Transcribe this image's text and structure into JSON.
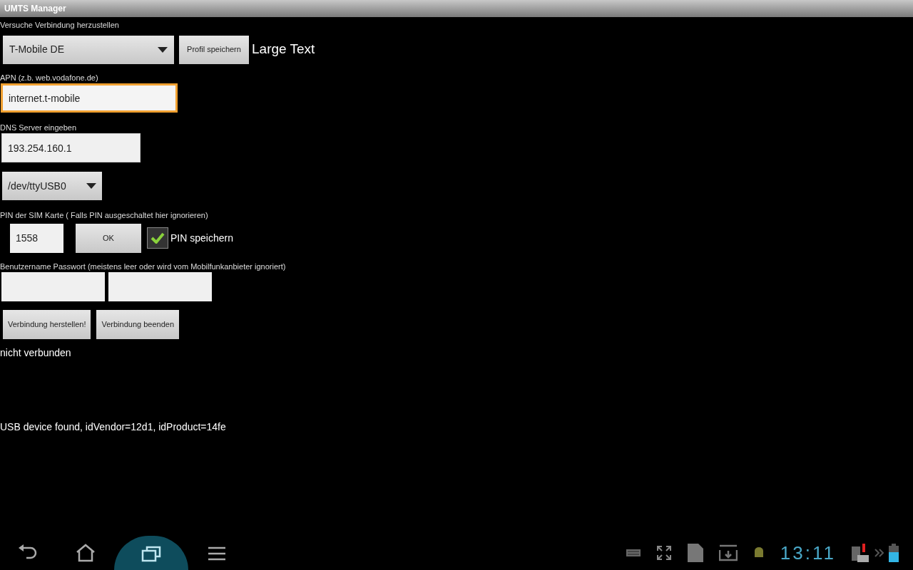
{
  "window": {
    "title": "UMTS Manager"
  },
  "status_text": "Versuche Verbindung herzustellen",
  "profile": {
    "value": "T-Mobile DE",
    "save_button": "Profil speichern",
    "large_text": "Large Text"
  },
  "apn": {
    "label": "APN (z.b. web.vodafone.de)",
    "value": "internet.t-mobile",
    "focused": true
  },
  "dns": {
    "label": "DNS Server eingeben",
    "value": "193.254.160.1"
  },
  "device": {
    "value": "/dev/ttyUSB0"
  },
  "pin": {
    "label": "PIN der SIM Karte ( Falls PIN ausgeschaltet hier ignorieren)",
    "value": "1558",
    "ok_button": "OK",
    "save_pin": {
      "label": "PIN speichern",
      "checked": true
    }
  },
  "credentials": {
    "label": "Benutzername Passwort (meistens leer oder wird vom Mobilfunkanbieter ignoriert)"
  },
  "buttons": [
    "Verbindung herstellen!",
    "Verbindung beenden"
  ],
  "connection_status": "nicht verbunden",
  "usb_message": "USB device found, idVendor=12d1, idProduct=14fe",
  "nav_bar": {
    "buttons": [
      {
        "kind": "back",
        "selected": false
      },
      {
        "kind": "home",
        "selected": false
      },
      {
        "kind": "recents",
        "selected": true
      },
      {
        "kind": "menu",
        "selected": false
      }
    ],
    "clock": "13:11"
  }
}
